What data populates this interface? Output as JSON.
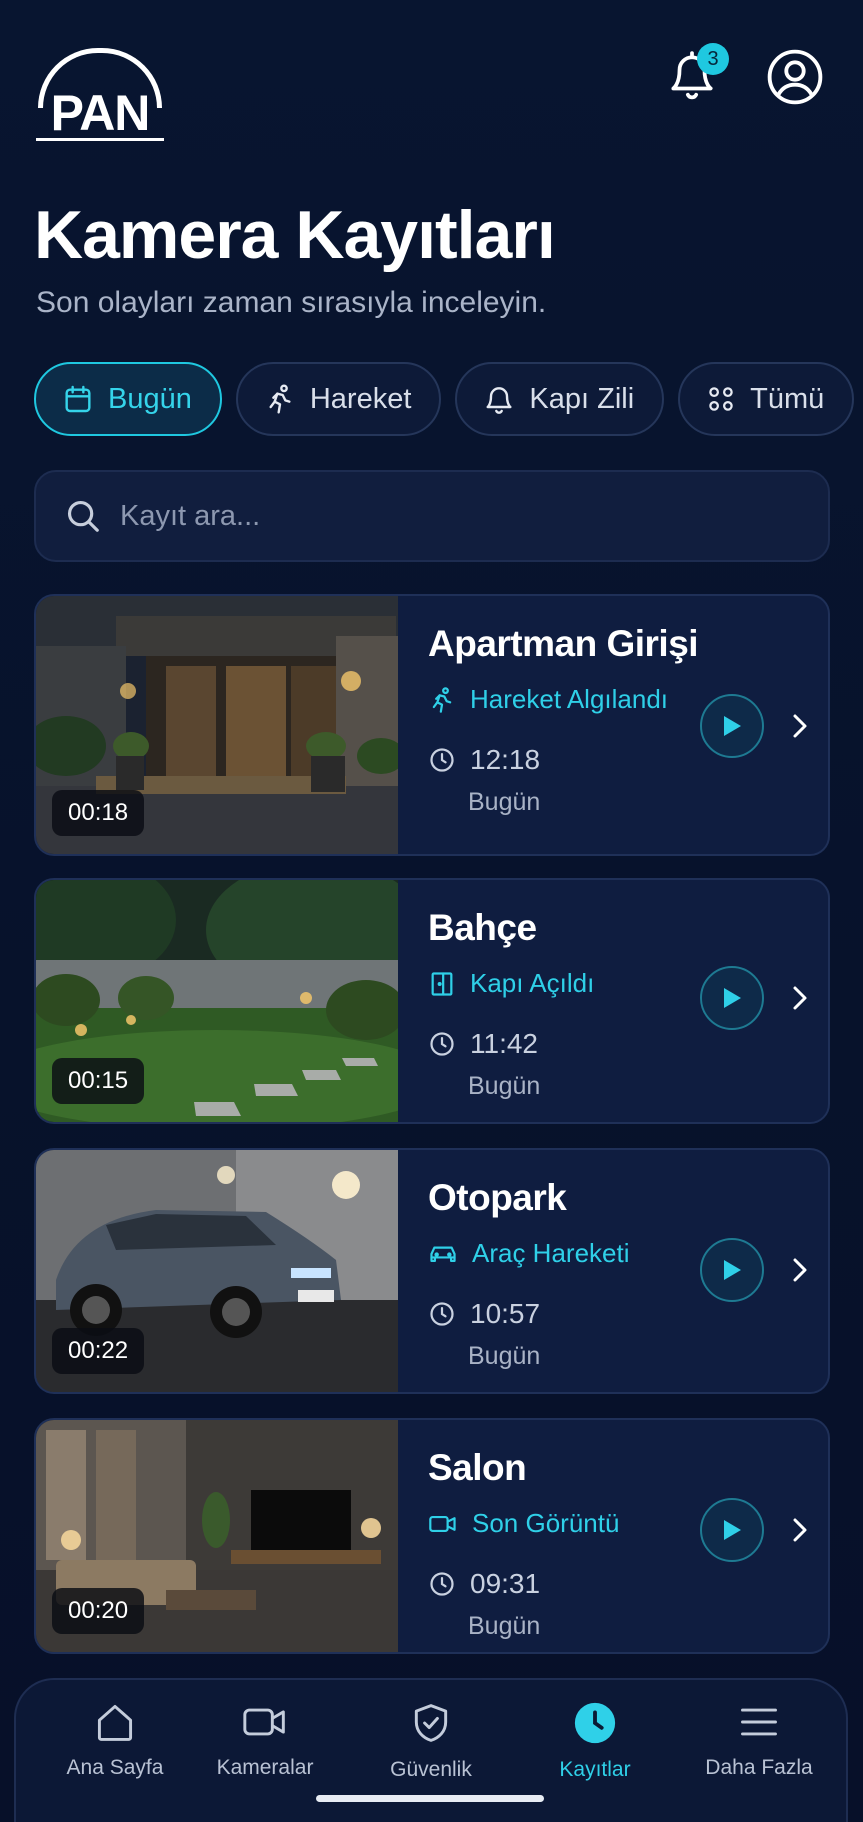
{
  "brand": {
    "logo_text": "PAN"
  },
  "header": {
    "notification_count": "3",
    "notification_icon": "bell-icon",
    "profile_icon": "user-circle-icon"
  },
  "page": {
    "title": "Kamera Kayıtları",
    "subtitle": "Son olayları zaman sırasıyla inceleyin."
  },
  "filters": [
    {
      "label": "Bugün",
      "icon": "calendar-icon",
      "active": true
    },
    {
      "label": "Hareket",
      "icon": "running-person-icon",
      "active": false
    },
    {
      "label": "Kapı Zili",
      "icon": "bell-icon",
      "active": false
    },
    {
      "label": "Tümü",
      "icon": "grid-icon",
      "active": false
    }
  ],
  "search": {
    "placeholder": "Kayıt ara...",
    "value": ""
  },
  "recordings": [
    {
      "camera": "Apartman Girişi",
      "event": "Hareket Algılandı",
      "event_icon": "running-person-icon",
      "time": "12:18",
      "day": "Bugün",
      "duration": "00:18"
    },
    {
      "camera": "Bahçe",
      "event": "Kapı Açıldı",
      "event_icon": "door-icon",
      "time": "11:42",
      "day": "Bugün",
      "duration": "00:15"
    },
    {
      "camera": "Otopark",
      "event": "Araç Hareketi",
      "event_icon": "car-icon",
      "time": "10:57",
      "day": "Bugün",
      "duration": "00:22"
    },
    {
      "camera": "Salon",
      "event": "Son Görüntü",
      "event_icon": "video-camera-icon",
      "time": "09:31",
      "day": "Bugün",
      "duration": "00:20"
    }
  ],
  "bottom_nav": [
    {
      "label": "Ana Sayfa",
      "icon": "home-icon",
      "active": false
    },
    {
      "label": "Kameralar",
      "icon": "video-camera-icon",
      "active": false
    },
    {
      "label": "Güvenlik",
      "icon": "shield-check-icon",
      "active": false
    },
    {
      "label": "Kayıtlar",
      "icon": "clock-icon",
      "active": true
    },
    {
      "label": "Daha Fazla",
      "icon": "menu-icon",
      "active": false
    }
  ],
  "colors": {
    "accent": "#2fd0e8",
    "background": "#07112b",
    "card": "#0f1d40"
  }
}
